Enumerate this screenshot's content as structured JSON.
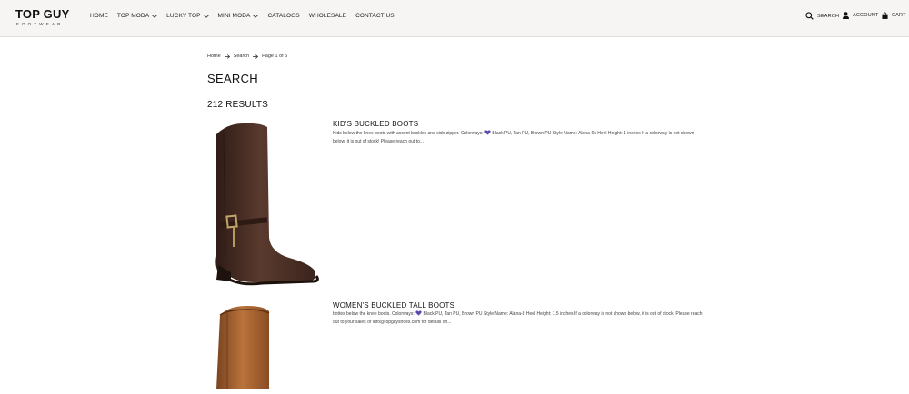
{
  "header": {
    "logo_main": "TOP GUY",
    "logo_sub": "FOOTWEAR",
    "nav": [
      {
        "label": "HOME",
        "dropdown": false
      },
      {
        "label": "TOP MODA",
        "dropdown": true
      },
      {
        "label": "LUCKY TOP",
        "dropdown": true
      },
      {
        "label": "MINI MODA",
        "dropdown": true
      },
      {
        "label": "CATALOGS",
        "dropdown": false
      },
      {
        "label": "WHOLESALE",
        "dropdown": false
      },
      {
        "label": "CONTACT US",
        "dropdown": false
      }
    ],
    "search_label": "SEARCH",
    "account_label": "ACCOUNT",
    "cart_label": "CART"
  },
  "breadcrumb": {
    "home": "Home",
    "search": "Search",
    "page": "Page 1 of 5"
  },
  "page": {
    "title": "SEARCH",
    "results": "212 RESULTS"
  },
  "products": [
    {
      "name": "KID'S BUCKLED BOOTS",
      "desc_before": "Kids below the knee boots with accent buckles and side zipper.  Colorways: ",
      "desc_after": " Black PU, Tan PU, Brown PU Style Name: Alana-6k Heel Height: 1 inches If a colorway is not shown below, it is out of stock! Please reach out to...",
      "boot_color": "#4a2f25"
    },
    {
      "name": "WOMEN'S BUCKLED TALL BOOTS",
      "desc_before": "bottes below the knee boots.  Colorways: ",
      "desc_after": " Black PU, Tan PU, Brown PU Style Name: Alana-8 Heel Height: 1.5 inches If a colorway is not shown below, it is out of stock! Please reach out to your sales or info@topguyshoes.com for details on...",
      "boot_color": "#a5622f"
    }
  ],
  "colors": {
    "header_bg": "#f6f5f3",
    "heart": "#5a49b0"
  }
}
